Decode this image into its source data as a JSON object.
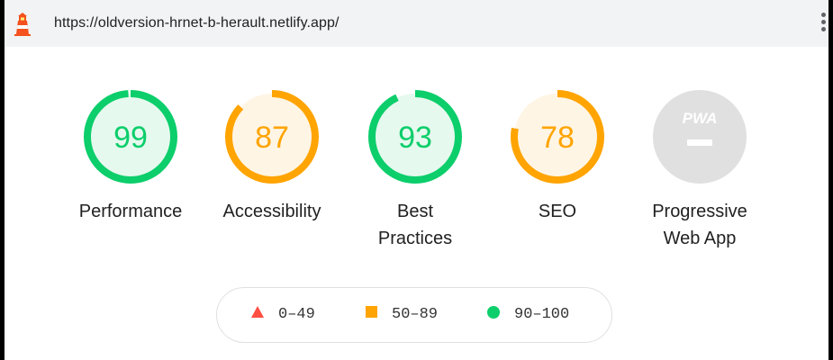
{
  "topbar": {
    "url": "https://oldversion-hrnet-b-herault.netlify.app/",
    "logo_icon": "lighthouse-icon",
    "menu_icon": "more-vertical-icon"
  },
  "gauges": [
    {
      "key": "performance",
      "score": 99,
      "score_text": "99",
      "label_lines": [
        "Performance"
      ],
      "rating": "pass"
    },
    {
      "key": "accessibility",
      "score": 87,
      "score_text": "87",
      "label_lines": [
        "Accessibility"
      ],
      "rating": "average"
    },
    {
      "key": "best-practices",
      "score": 93,
      "score_text": "93",
      "label_lines": [
        "Best",
        "Practices"
      ],
      "rating": "pass"
    },
    {
      "key": "seo",
      "score": 78,
      "score_text": "78",
      "label_lines": [
        "SEO"
      ],
      "rating": "average"
    },
    {
      "key": "pwa",
      "score": null,
      "badge_text": "PWA",
      "label_lines": [
        "Progressive",
        "Web App"
      ],
      "rating": "na"
    }
  ],
  "legend": [
    {
      "shape": "triangle",
      "range": "0–49"
    },
    {
      "shape": "square",
      "range": "50–89"
    },
    {
      "shape": "circle",
      "range": "90–100"
    }
  ],
  "colors": {
    "pass": "#0cce6b",
    "pass_fill": "#e6f9ee",
    "pass_text": "#008800",
    "average": "#ffa400",
    "average_fill": "#fff5e5",
    "average_text": "#c33300",
    "fail": "#ff4e42",
    "na_fill": "#e0e0e0",
    "na_mark": "#ffffff",
    "lighthouse_orange": "#f4511e"
  }
}
